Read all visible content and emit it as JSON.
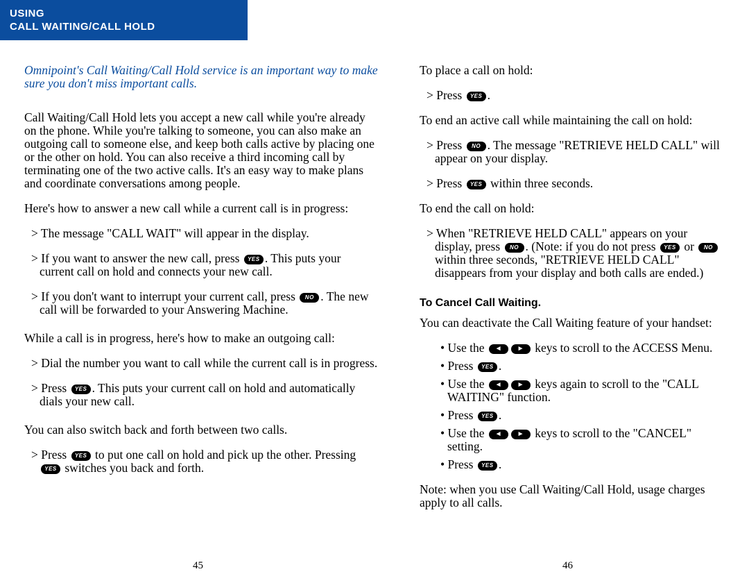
{
  "header": {
    "line1": "USING",
    "line2": "CALL WAITING/CALL HOLD"
  },
  "intro": "Omnipoint's Call Waiting/Call Hold service is an important way to make sure you don't miss important calls.",
  "keys": {
    "yes": "YES",
    "no": "NO",
    "left": "◄",
    "right": "►"
  },
  "left": {
    "p1": "Call Waiting/Call Hold lets you accept a new call while you're already on the phone.  While you're talking to someone, you can also make an outgoing call to someone else, and keep both calls active by placing one or the other on hold.  You can also receive a third incoming call by terminating one of the two active calls.  It's an easy way to make plans and coordinate conversations among people.",
    "p2": "Here's how to answer a new call while a current call is in progress:",
    "b1": "> The message \"CALL WAIT\" will appear in the display.",
    "b2a": "> If you want to answer the new call, press ",
    "b2b": ".  This puts your current call on hold and connects your new call.",
    "b3a": "> If you don't want to interrupt your current call, press ",
    "b3b": ". The new call will be forwarded to your Answering Machine.",
    "p3": "While a call is in progress, here's how to make an outgoing call:",
    "c1": "> Dial the number you want to call while the current call is in progress.",
    "c2a": "> Press ",
    "c2b": ".  This puts your current call on hold and automatically dials your new call.",
    "p4": "You can also switch back and forth between two calls.",
    "d1a": "> Press ",
    "d1b": " to put one call on hold and pick up the other.  Pressing ",
    "d1c": " switches you back and forth."
  },
  "right": {
    "r1": "To place a call on hold:",
    "r1a": "> Press ",
    "r1b": ".",
    "r2": "To end an active call while maintaining the call on hold:",
    "r2a": "> Press ",
    "r2b": ".  The message \"RETRIEVE HELD CALL\" will appear on your display.",
    "r2c": "> Press ",
    "r2d": " within three seconds.",
    "r3": "To end the call on hold:",
    "r3a": "> When \"RETRIEVE HELD CALL\" appears on your display, press ",
    "r3b": ".  (Note: if you do not press ",
    "r3c": " or ",
    "r3d": " within three seconds, \"RETRIEVE HELD CALL\" disappears from your display and both calls are ended.)",
    "h": "To Cancel Call Waiting.",
    "r4": "You can deactivate the Call Waiting feature of your handset:",
    "u1a": "•  Use the ",
    "u1b": " keys to scroll to the ACCESS Menu.",
    "u2a": "•  Press ",
    "u2b": ".",
    "u3a": "•  Use the ",
    "u3b": " keys again to scroll to the \"CALL WAITING\" function.",
    "u4a": "•  Press ",
    "u4b": ".",
    "u5a": "•  Use the ",
    "u5b": " keys to scroll to the \"CANCEL\" setting.",
    "u6a": "•  Press ",
    "u6b": ".",
    "note": "Note: when you use Call Waiting/Call Hold, usage charges apply to all calls."
  },
  "pages": {
    "left": "45",
    "right": "46"
  }
}
